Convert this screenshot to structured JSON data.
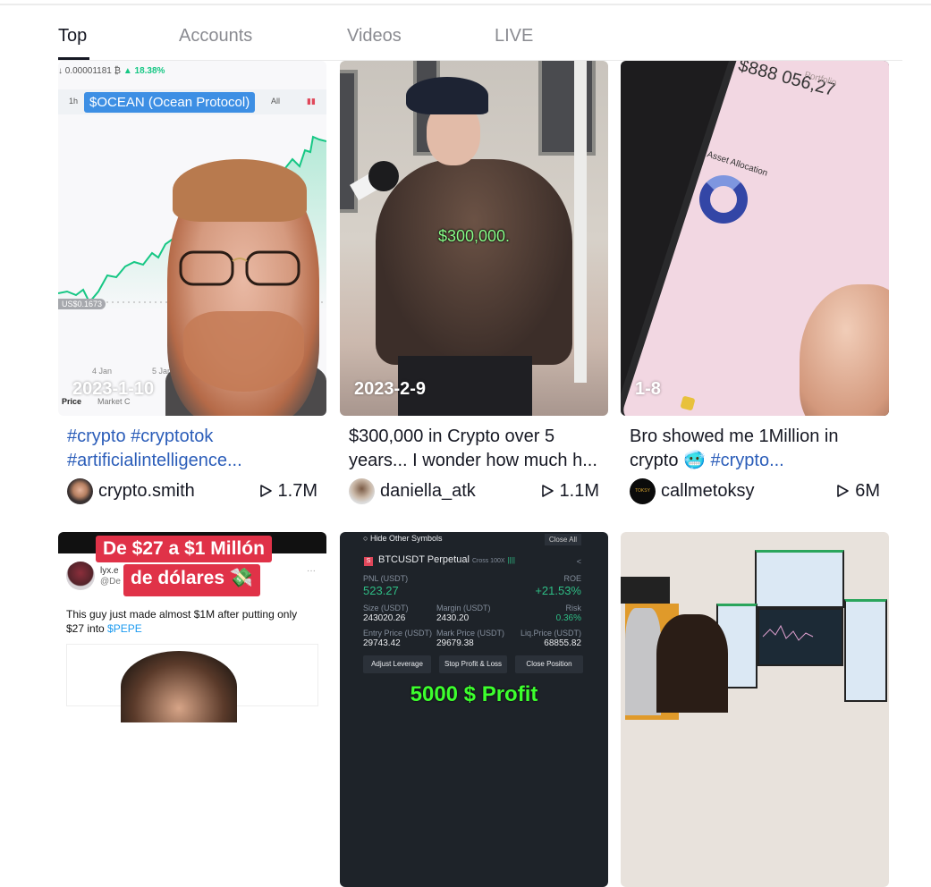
{
  "tabs": [
    {
      "label": "Top",
      "active": true
    },
    {
      "label": "Accounts",
      "active": false
    },
    {
      "label": "Videos",
      "active": false
    },
    {
      "label": "LIVE",
      "active": false
    }
  ],
  "videos": [
    {
      "date": "2023-1-10",
      "caption_parts": [
        {
          "text": "#crypto #cryptotok",
          "tag": true
        },
        {
          "text": "#artificialintelligence...",
          "tag": true
        }
      ],
      "author": "crypto.smith",
      "views": "1.7M",
      "thumb": {
        "price_btc": "↓ 0.00001181 ₿",
        "change": "▲ 18.38%",
        "range_1h": "1h",
        "range_all": "All",
        "overlay_label": "$OCEAN (Ocean Protocol)",
        "price_pill": "US$0.1673",
        "x_ticks": [
          "4 Jan",
          "5 Jan"
        ],
        "tab_price": "Price",
        "tab_market": "Market C"
      }
    },
    {
      "date": "2023-2-9",
      "caption_parts": [
        {
          "text": "$300,000 in Crypto over 5 years... I wonder how much h...",
          "tag": false
        }
      ],
      "author": "daniella_atk",
      "views": "1.1M",
      "thumb": {
        "overlay_text": "$300,000."
      }
    },
    {
      "date": "1-8",
      "caption_parts": [
        {
          "text": "Bro showed me 1Million in crypto 🥶 ",
          "tag": false
        },
        {
          "text": "#crypto...",
          "tag": true
        }
      ],
      "author": "callmetoksy",
      "views": "6M",
      "thumb": {
        "balance": "$888 056,27",
        "portfolio": "Portfolio",
        "asset_allocation": "Asset Allocation"
      }
    },
    {
      "thumb": {
        "title_line1": "De $27 a $1 Millón",
        "title_line2": "de dólares 💸",
        "tw_name": "lyx.e",
        "tw_handle": "@De",
        "tweet_text": "This guy just made almost $1M after putting only $27 into ",
        "tweet_link": "$PEPE",
        "dots": "···"
      }
    },
    {
      "thumb": {
        "hide_other": "Hide Other Symbols",
        "close_all": "Close All",
        "symbol": "BTCUSDT Perpetual",
        "cross": "Cross 100X",
        "pnl_label": "PNL (USDT)",
        "pnl_value": "523.27",
        "roe_label": "ROE",
        "roe_value": "+21.53%",
        "size_label": "Size (USDT)",
        "size_value": "243020.26",
        "margin_label": "Margin (USDT)",
        "margin_value": "2430.20",
        "risk_label": "Risk",
        "risk_value": "0.36%",
        "entry_label": "Entry Price (USDT)",
        "entry_value": "29743.42",
        "mark_label": "Mark Price (USDT)",
        "mark_value": "29679.38",
        "liq_label": "Liq.Price (USDT)",
        "liq_value": "68855.82",
        "btn_leverage": "Adjust Leverage",
        "btn_stop": "Stop Profit & Loss",
        "btn_close": "Close Position",
        "profit_text": "5000 $ Profit"
      }
    },
    {
      "thumb": {}
    }
  ]
}
